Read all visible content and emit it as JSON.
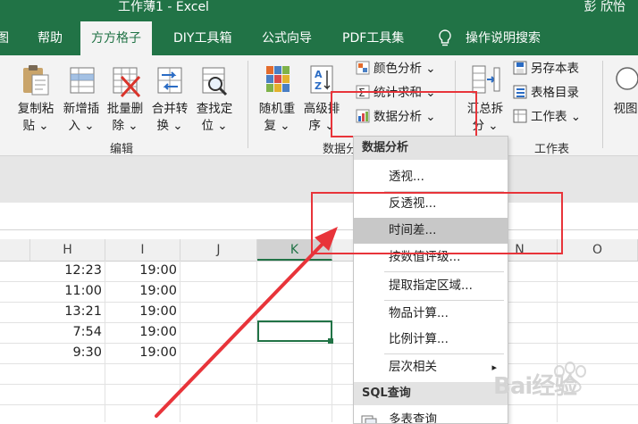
{
  "window": {
    "title": "工作薄1 - Excel",
    "user": "彭 欣怡"
  },
  "tabs": [
    {
      "label": "图"
    },
    {
      "label": "帮助"
    },
    {
      "label": "方方格子",
      "active": true
    },
    {
      "label": "DIY工具箱"
    },
    {
      "label": "公式向导"
    },
    {
      "label": "PDF工具集"
    },
    {
      "label": "操作说明搜索"
    }
  ],
  "ribbon": {
    "edit_group": {
      "label": "编辑",
      "buttons": [
        {
          "line1": "复制粘",
          "line2": "贴 ⌄"
        },
        {
          "line1": "新增插",
          "line2": "入 ⌄"
        },
        {
          "line1": "批量删",
          "line2": "除 ⌄"
        },
        {
          "line1": "合并转",
          "line2": "换 ⌄"
        },
        {
          "line1": "查找定",
          "line2": "位 ⌄"
        }
      ]
    },
    "data_group": {
      "label": "数据分",
      "buttons": [
        {
          "line1": "随机重",
          "line2": "复 ⌄"
        },
        {
          "line1": "高级排",
          "line2": "序 ⌄"
        }
      ],
      "small": [
        {
          "label": "颜色分析 ⌄"
        },
        {
          "label": "统计求和 ⌄"
        },
        {
          "label": "数据分析 ⌄"
        }
      ]
    },
    "sheet_group": {
      "label": "工作表",
      "big": {
        "line1": "汇总拆",
        "line2": "分 ⌄"
      },
      "small": [
        {
          "label": "另存本表"
        },
        {
          "label": "表格目录"
        },
        {
          "label": "工作表 ⌄"
        }
      ]
    },
    "view": {
      "line1": "视图"
    }
  },
  "sheet": {
    "columns": [
      "H",
      "I",
      "J",
      "K",
      "N",
      "O"
    ],
    "rows": [
      {
        "h": "12:23",
        "i": "19:00"
      },
      {
        "h": "11:00",
        "i": "19:00"
      },
      {
        "h": "13:21",
        "i": "19:00"
      },
      {
        "h": "7:54",
        "i": "19:00"
      },
      {
        "h": "9:30",
        "i": "19:00"
      }
    ]
  },
  "menu": {
    "header1": "数据分析",
    "items": [
      {
        "label": "透视..."
      },
      {
        "label": "反透视..."
      },
      {
        "label": "时间差..."
      },
      {
        "label": "按数值评级..."
      },
      {
        "label": "提取指定区域..."
      },
      {
        "label": "物品计算..."
      },
      {
        "label": "比例计算..."
      },
      {
        "label": "层次相关"
      }
    ],
    "submenu_arrow": "▸",
    "header2": "SQL查询",
    "last_item": "多表查询"
  },
  "watermark": {
    "text": "Bai经验"
  },
  "colors": {
    "excel_green": "#217346",
    "highlight_red": "#e8343a"
  }
}
